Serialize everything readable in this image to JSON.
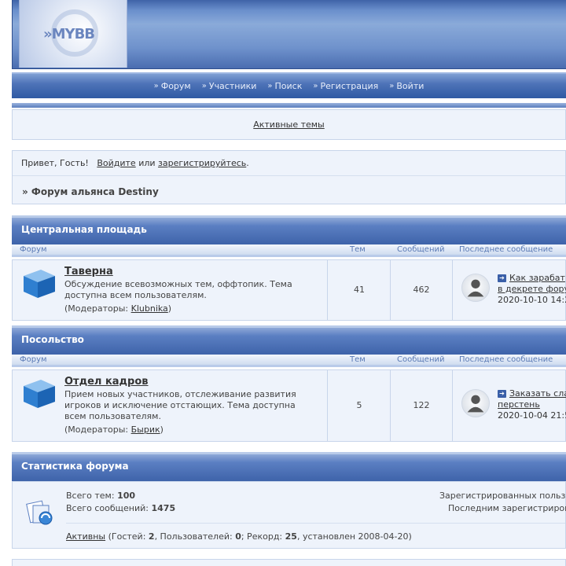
{
  "header": {
    "logo_text": "»MYBB"
  },
  "nav": [
    {
      "label": "Форум"
    },
    {
      "label": "Участники"
    },
    {
      "label": "Поиск"
    },
    {
      "label": "Регистрация"
    },
    {
      "label": "Войти"
    }
  ],
  "active_topics": "Активные темы",
  "greeting": {
    "prefix": "Привет, Гость!",
    "login": "Войдите",
    "or": "или",
    "register": "зарегистрируйтесь",
    "suffix": "."
  },
  "breadcrumb": "» Форум альянса Destiny",
  "columns": {
    "forum": "Форум",
    "topics": "Тем",
    "posts": "Сообщений",
    "last": "Последнее сообщение"
  },
  "categories": [
    {
      "title": "Центральная площадь",
      "forum": {
        "name": "Таверна",
        "desc": "Обсуждение всевозможных тем, оффтопик. Тема доступна всем пользователям.",
        "mods_label": "(Модераторы:",
        "mod": "Klubnika",
        "mods_close": ")",
        "topics": "41",
        "posts": "462",
        "last_title_1": "Как зарабат",
        "last_title_2": "в декрете фору",
        "last_date": "2020-10-10 14:2"
      }
    },
    {
      "title": "Посольство",
      "forum": {
        "name": "Отдел кадров",
        "desc": "Прием новых участников, отслеживание развития игроков и исключение отстающих. Тема доступна всем пользователям.",
        "mods_label": "(Модераторы:",
        "mod": "Бырик",
        "mods_close": ")",
        "topics": "5",
        "posts": "122",
        "last_title_1": "Заказать сла",
        "last_title_2": "перстень",
        "last_date": "2020-10-04 21:5"
      }
    }
  ],
  "stats": {
    "title": "Статистика форума",
    "topics_label": "Всего тем:",
    "topics": "100",
    "posts_label": "Всего сообщений:",
    "posts": "1475",
    "registered": "Зарегистрированных польз",
    "last_registered": "Последним зарегистриров",
    "active_link": "Активны",
    "guests_label": "(Гостей:",
    "guests": "2",
    "users_label": ", Пользователей:",
    "users": "0",
    "record_label": "; Рекорд:",
    "record": "25",
    "record_suffix": ", установлен 2008-04-20)"
  },
  "colors": {
    "accent": "#3e63aa",
    "panel": "#eef3fb",
    "border": "#c8d5ea"
  }
}
